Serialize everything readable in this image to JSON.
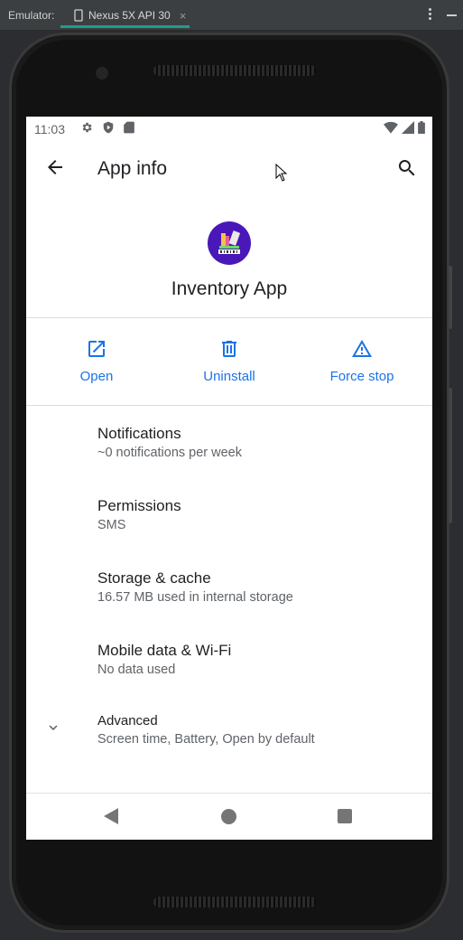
{
  "emulator": {
    "label": "Emulator:",
    "tab_title": "Nexus 5X API 30",
    "tab_close": "×"
  },
  "status_bar": {
    "time": "11:03",
    "left_icons": [
      "gear-icon",
      "shield-icon",
      "sd-card-icon"
    ],
    "right_icons": [
      "wifi-icon",
      "cell-signal-icon",
      "battery-icon"
    ]
  },
  "app_bar": {
    "title": "App info",
    "back_icon": "arrow-back-icon",
    "search_icon": "search-icon"
  },
  "app": {
    "name": "Inventory App",
    "icon_bg": "#4a18b8"
  },
  "actions": [
    {
      "label": "Open",
      "icon": "open-external-icon"
    },
    {
      "label": "Uninstall",
      "icon": "trash-icon"
    },
    {
      "label": "Force stop",
      "icon": "warning-icon"
    }
  ],
  "settings": [
    {
      "title": "Notifications",
      "subtitle": "~0 notifications per week"
    },
    {
      "title": "Permissions",
      "subtitle": "SMS"
    },
    {
      "title": "Storage & cache",
      "subtitle": "16.57 MB used in internal storage"
    },
    {
      "title": "Mobile data & Wi-Fi",
      "subtitle": "No data used"
    },
    {
      "title": "Advanced",
      "subtitle": "Screen time, Battery, Open by default"
    }
  ],
  "colors": {
    "accent": "#1a73e8",
    "text_primary": "#202124",
    "text_secondary": "#5f6368",
    "emulator_tab_indicator": "#1e9e8a"
  }
}
